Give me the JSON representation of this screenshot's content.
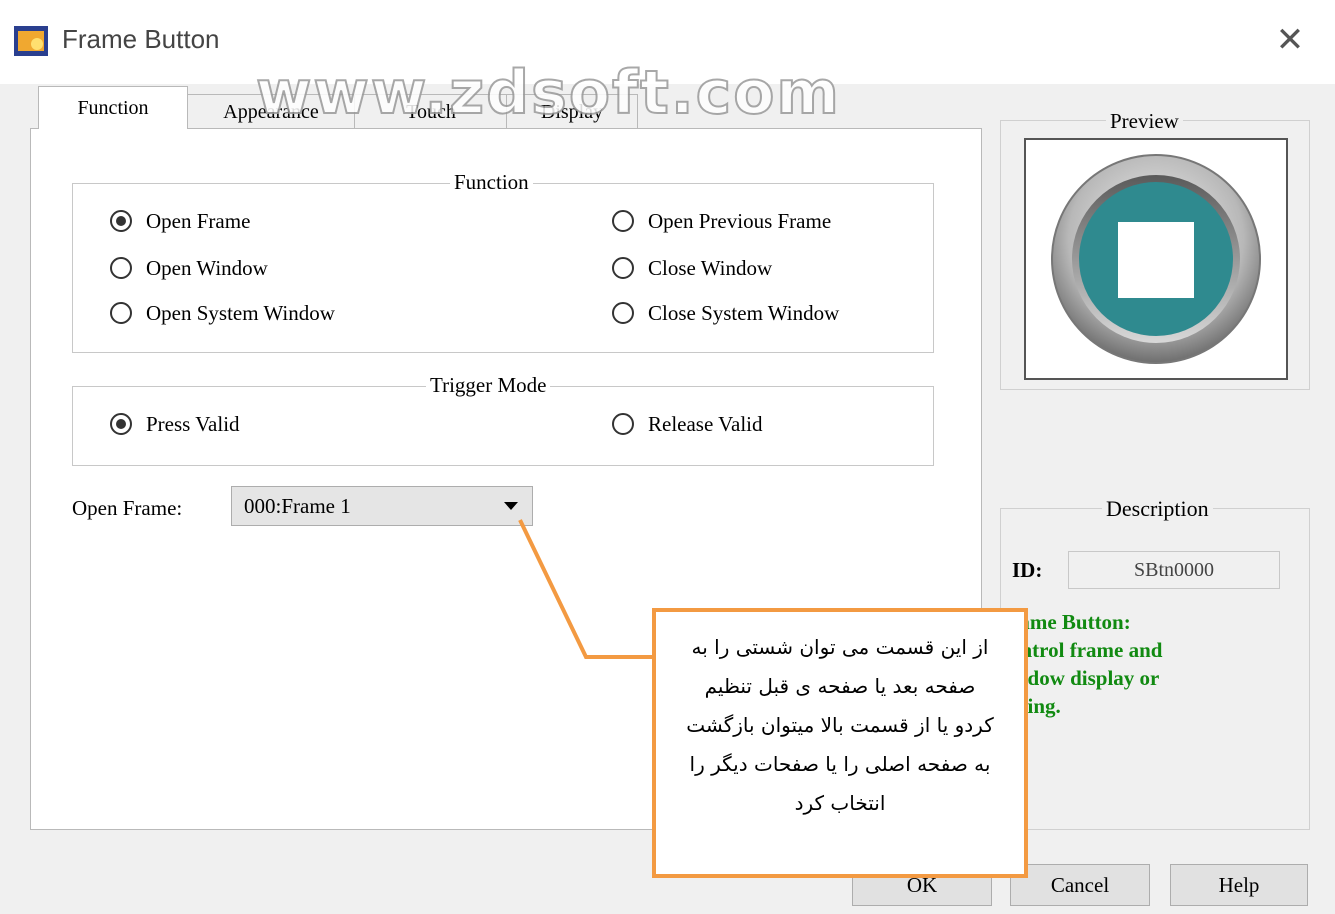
{
  "window": {
    "title": "Frame Button",
    "close_glyph": "✕",
    "app_icon": "frame-button-app-icon"
  },
  "watermark": "www.zdsoft.com",
  "tabs": [
    {
      "label": "Function",
      "active": true
    },
    {
      "label": "Appearance",
      "active": false
    },
    {
      "label": "Touch",
      "active": false
    },
    {
      "label": "Display",
      "active": false
    }
  ],
  "function_group": {
    "title": "Function",
    "options": [
      {
        "label": "Open Frame",
        "checked": true
      },
      {
        "label": "Open Previous Frame",
        "checked": false
      },
      {
        "label": "Open Window",
        "checked": false
      },
      {
        "label": "Close Window",
        "checked": false
      },
      {
        "label": "Open System Window",
        "checked": false
      },
      {
        "label": "Close System Window",
        "checked": false
      }
    ]
  },
  "trigger_group": {
    "title": "Trigger Mode",
    "options": [
      {
        "label": "Press Valid",
        "checked": true
      },
      {
        "label": "Release Valid",
        "checked": false
      }
    ]
  },
  "open_frame": {
    "label": "Open Frame:",
    "value": "000:Frame 1"
  },
  "preview": {
    "title": "Preview",
    "colors": {
      "ring": "#9a9a9a",
      "face": "#2f8a8f",
      "square": "#ffffff"
    }
  },
  "description": {
    "title": "Description",
    "id_label": "ID:",
    "id_value": "SBtn0000",
    "lines": [
      "rame Button:",
      "ontrol frame and",
      "indow display or",
      "iding."
    ],
    "text_color": "#118a11"
  },
  "buttons": {
    "ok": "OK",
    "cancel": "Cancel",
    "help": "Help"
  },
  "callout": {
    "border_color": "#f39a42",
    "lines": [
      "از این قسمت می توان شستی را به",
      "صفحه بعد یا صفحه ی قبل تنظیم",
      "کردو یا از قسمت بالا میتوان بازگشت",
      "به صفحه اصلی را یا صفحات دیگر را",
      "انتخاب کرد"
    ]
  }
}
